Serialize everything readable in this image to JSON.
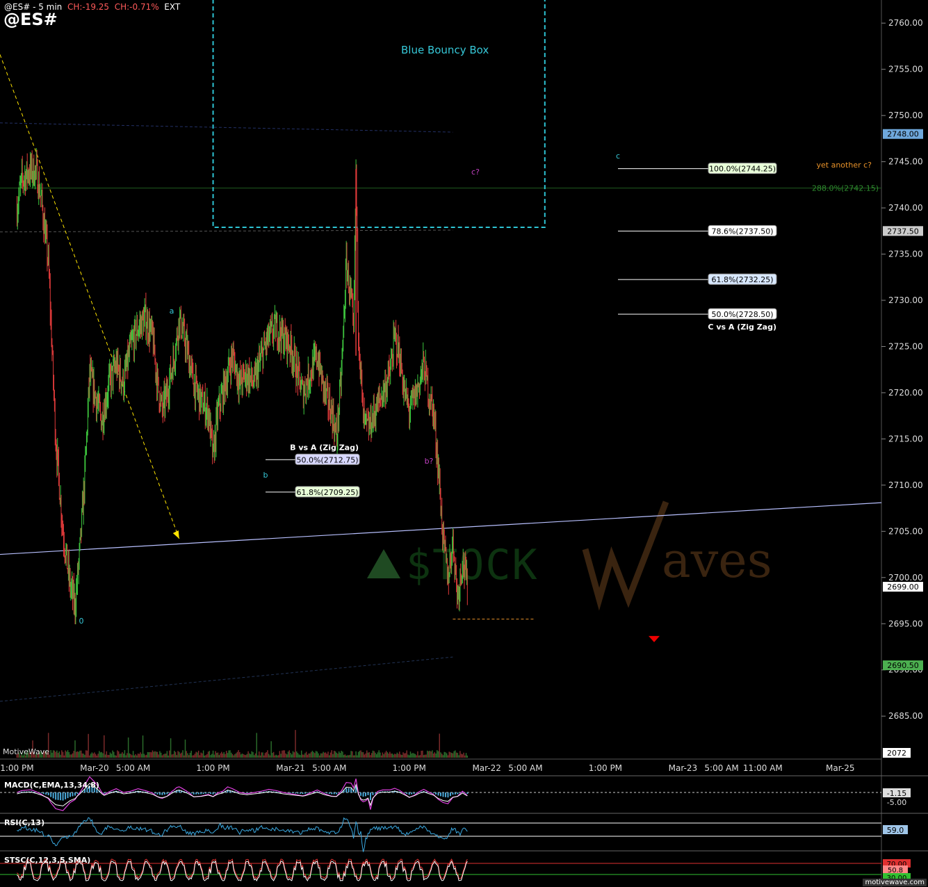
{
  "header": {
    "symbol_interval": "@ES# - 5 min",
    "change": "CH:-19.25",
    "change_pct": "CH:-0.71%",
    "session": "EXT",
    "symbol": "@ES#"
  },
  "watermark": {
    "text": "$TOCK",
    "brand": "Waves"
  },
  "vendor": "MotiveWave",
  "footer": "motivewave.com",
  "annotations": {
    "box_label": "Blue Bouncy Box",
    "wave_a": "a",
    "wave_b": "b",
    "wave_0": "0",
    "wave_c_target": "c",
    "wave_b_q": "b?",
    "wave_c_q": "c?",
    "yet_another": "yet another c?",
    "fib_c_title": "C vs A (Zig Zag)",
    "fib_b_title": "B vs A (Zig Zag)"
  },
  "fib_c": [
    {
      "label": "100.0%(2744.25)",
      "price": 2744.25,
      "bg": "#e8ffd8"
    },
    {
      "label": "78.6%(2737.50)",
      "price": 2737.5,
      "bg": "#ffffff"
    },
    {
      "label": "61.8%(2732.25)",
      "price": 2732.25,
      "bg": "#d8e8ff"
    },
    {
      "label": "50.0%(2728.50)",
      "price": 2728.5,
      "bg": "#ffffff"
    }
  ],
  "fib_b": [
    {
      "label": "50.0%(2712.75)",
      "price": 2712.75,
      "bg": "#d8d8ff"
    },
    {
      "label": "61.8%(2709.25)",
      "price": 2709.25,
      "bg": "#e8ffd8"
    }
  ],
  "extension_label": "288.0%(2742.15)",
  "price_tags": [
    {
      "text": "2748.00",
      "price": 2748.0,
      "bg": "#6fa8dc",
      "fg": "#000"
    },
    {
      "text": "2737.50",
      "price": 2737.5,
      "bg": "#cccccc",
      "fg": "#000"
    },
    {
      "text": "2699.00",
      "price": 2699.0,
      "bg": "#ffffff",
      "fg": "#000"
    },
    {
      "text": "2690.50",
      "price": 2690.5,
      "bg": "#4caf50",
      "fg": "#000"
    }
  ],
  "volume_tag": "2072",
  "indicators": {
    "macd": {
      "label": "MACD(C,EMA,13,34,8)",
      "tag1": "-1.15",
      "tag2": "-5.00"
    },
    "rsi": {
      "label": "RSI(C,13)",
      "tag": "59.0"
    },
    "stoch": {
      "label": "STSC(C,12,3,5,SMA)",
      "tag1": "70.00",
      "tag2": "50.8",
      "tag3": "30.00"
    }
  },
  "colors": {
    "up": "#3ec83e",
    "down": "#e23b3b",
    "box": "#2ec4d4",
    "trend": "#b8c0ff",
    "yellow": "#ffe400"
  },
  "chart_data": {
    "type": "candlestick",
    "title": "@ES#",
    "interval": "5 min",
    "y_ticks": [
      2685,
      2690,
      2695,
      2700,
      2705,
      2710,
      2715,
      2720,
      2725,
      2730,
      2735,
      2740,
      2745,
      2750,
      2755,
      2760
    ],
    "y_tick_labels": [
      "2685.00",
      "2690.00",
      "2695.00",
      "2700.00",
      "2705.00",
      "2710.00",
      "2715.00",
      "2720.00",
      "2725.00",
      "2730.00",
      "2735.00",
      "2740.00",
      "2745.00",
      "2750.00",
      "2755.00",
      "2760.00"
    ],
    "ylim": [
      2680.5,
      2762.5
    ],
    "x_labels": [
      "1:00 PM",
      "Mar-20",
      "5:00 AM",
      "1:00 PM",
      "Mar-21",
      "5:00 AM",
      "1:00 PM",
      "Mar-22",
      "5:00 AM",
      "1:00 PM",
      "Mar-23",
      "5:00 AM",
      "11:00 AM",
      "Mar-25"
    ],
    "x_label_pos": [
      0,
      32,
      48,
      81,
      113,
      129,
      162,
      194,
      210,
      243,
      275,
      291,
      308,
      340
    ],
    "x_range": [
      -7,
      357
    ],
    "price_path": [
      [
        0,
        2740
      ],
      [
        2,
        2743
      ],
      [
        5,
        2744
      ],
      [
        8,
        2744
      ],
      [
        10,
        2741
      ],
      [
        13,
        2734
      ],
      [
        16,
        2715
      ],
      [
        19,
        2705
      ],
      [
        22,
        2699
      ],
      [
        24,
        2697
      ],
      [
        26,
        2703
      ],
      [
        28,
        2711
      ],
      [
        30,
        2722
      ],
      [
        32,
        2720
      ],
      [
        35,
        2717
      ],
      [
        38,
        2721
      ],
      [
        41,
        2723
      ],
      [
        44,
        2721
      ],
      [
        47,
        2725
      ],
      [
        50,
        2727
      ],
      [
        53,
        2728
      ],
      [
        56,
        2726
      ],
      [
        58,
        2721
      ],
      [
        60,
        2718
      ],
      [
        62,
        2720
      ],
      [
        65,
        2724
      ],
      [
        67,
        2728
      ],
      [
        70,
        2725
      ],
      [
        73,
        2721
      ],
      [
        76,
        2719
      ],
      [
        79,
        2718
      ],
      [
        81,
        2713
      ],
      [
        83,
        2718
      ],
      [
        86,
        2721
      ],
      [
        89,
        2724
      ],
      [
        92,
        2721
      ],
      [
        95,
        2722
      ],
      [
        98,
        2721
      ],
      [
        101,
        2724
      ],
      [
        104,
        2726
      ],
      [
        107,
        2727
      ],
      [
        110,
        2726
      ],
      [
        113,
        2725
      ],
      [
        116,
        2722
      ],
      [
        118,
        2720
      ],
      [
        121,
        2722
      ],
      [
        124,
        2724
      ],
      [
        127,
        2720
      ],
      [
        130,
        2718
      ],
      [
        132,
        2715
      ],
      [
        134,
        2722
      ],
      [
        136,
        2734
      ],
      [
        138,
        2730
      ],
      [
        139,
        2726
      ],
      [
        140,
        2744
      ],
      [
        141,
        2727
      ],
      [
        143,
        2717
      ],
      [
        145,
        2716
      ],
      [
        148,
        2718
      ],
      [
        151,
        2720
      ],
      [
        154,
        2722
      ],
      [
        156,
        2726
      ],
      [
        158,
        2724
      ],
      [
        160,
        2720
      ],
      [
        162,
        2718
      ],
      [
        165,
        2720
      ],
      [
        168,
        2723
      ],
      [
        170,
        2720
      ],
      [
        172,
        2718
      ],
      [
        174,
        2712
      ],
      [
        176,
        2704
      ],
      [
        178,
        2700
      ],
      [
        180,
        2704
      ],
      [
        182,
        2698
      ],
      [
        184,
        2702
      ],
      [
        186,
        2699
      ]
    ],
    "volume_scale_max": 2072,
    "fib_c_levels": [
      {
        "ratio": "100.0%",
        "price": 2744.25
      },
      {
        "ratio": "78.6%",
        "price": 2737.5
      },
      {
        "ratio": "61.8%",
        "price": 2732.25
      },
      {
        "ratio": "50.0%",
        "price": 2728.5
      }
    ],
    "fib_b_levels": [
      {
        "ratio": "50.0%",
        "price": 2712.75
      },
      {
        "ratio": "61.8%",
        "price": 2709.25
      }
    ],
    "extension": {
      "ratio": "288.0%",
      "price": 2742.15
    },
    "box": {
      "x": [
        81,
        218
      ],
      "price": [
        2737.9,
        2763
      ]
    },
    "trendline": {
      "x": [
        -7,
        357
      ],
      "price": [
        2702.5,
        2708.1
      ]
    },
    "upper_channel": {
      "x": [
        -7,
        180
      ],
      "price": [
        2749.2,
        2748.2
      ]
    },
    "mid_channel": {
      "x": [
        -7,
        180
      ],
      "price": [
        2737.4,
        2737.6
      ]
    },
    "lower_channel": {
      "x": [
        -7,
        180
      ],
      "price": [
        2686.6,
        2691.4
      ]
    },
    "yellow_line": {
      "x": [
        -7,
        67
      ],
      "price": [
        2756.6,
        2704.2
      ]
    },
    "support_dash": {
      "x": [
        180,
        214
      ],
      "price": 2695.5
    },
    "red_marker": {
      "x": 199,
      "price": 2693.3
    },
    "wave_points": [
      {
        "label": "0",
        "x": 24,
        "price": 2697
      },
      {
        "label": "a",
        "x": 50,
        "price": 2729
      },
      {
        "label": "b",
        "x": 79,
        "price": 2712
      },
      {
        "label": "b?",
        "x": 129,
        "price": 2714
      },
      {
        "label": "c?",
        "x": 143,
        "price": 2745
      },
      {
        "label": "c",
        "x": 187,
        "price": 2746
      }
    ],
    "macd": {
      "ylim": [
        -8,
        3
      ],
      "ref": [
        -1.15
      ],
      "scale_labels": [
        "-1.15",
        "-5.00"
      ]
    },
    "rsi": {
      "ylim": [
        20,
        80
      ],
      "ref": [
        70,
        30
      ],
      "last": 59.0
    },
    "stoch": {
      "ylim": [
        0,
        100
      ],
      "ref": [
        70,
        30
      ],
      "last": 50.8
    }
  }
}
